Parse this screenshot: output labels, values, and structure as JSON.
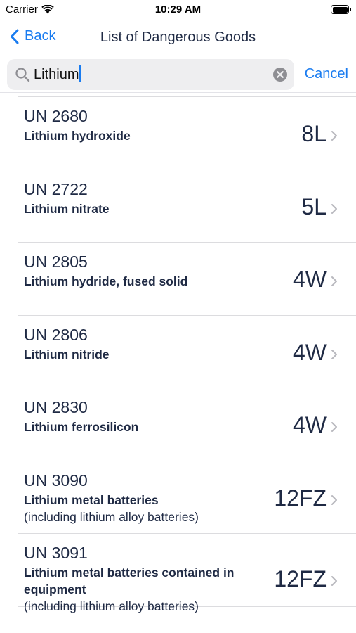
{
  "status": {
    "carrier": "Carrier",
    "time": "10:29 AM"
  },
  "nav": {
    "back_label": "Back",
    "title": "List of Dangerous Goods"
  },
  "search": {
    "value": "Lithium",
    "cancel_label": "Cancel"
  },
  "items": [
    {
      "un": "UN 2680",
      "name": "Lithium hydroxide",
      "note": "",
      "code": "8L"
    },
    {
      "un": "UN 2722",
      "name": "Lithium nitrate",
      "note": "",
      "code": "5L"
    },
    {
      "un": "UN 2805",
      "name": "Lithium hydride, fused solid",
      "note": "",
      "code": "4W"
    },
    {
      "un": "UN 2806",
      "name": "Lithium nitride",
      "note": "",
      "code": "4W"
    },
    {
      "un": "UN 2830",
      "name": "Lithium ferrosilicon",
      "note": "",
      "code": "4W"
    },
    {
      "un": "UN 3090",
      "name": "Lithium metal batteries",
      "note": "(including lithium alloy batteries)",
      "code": "12FZ"
    },
    {
      "un": "UN 3091",
      "name": "Lithium metal batteries contained in equipment",
      "note": "(including lithium alloy batteries)",
      "code": "12FZ"
    }
  ],
  "colors": {
    "accent": "#1a7cf0",
    "text": "#1f2a44",
    "search_bg": "#eeeef0",
    "separator": "#dcdcdf"
  }
}
